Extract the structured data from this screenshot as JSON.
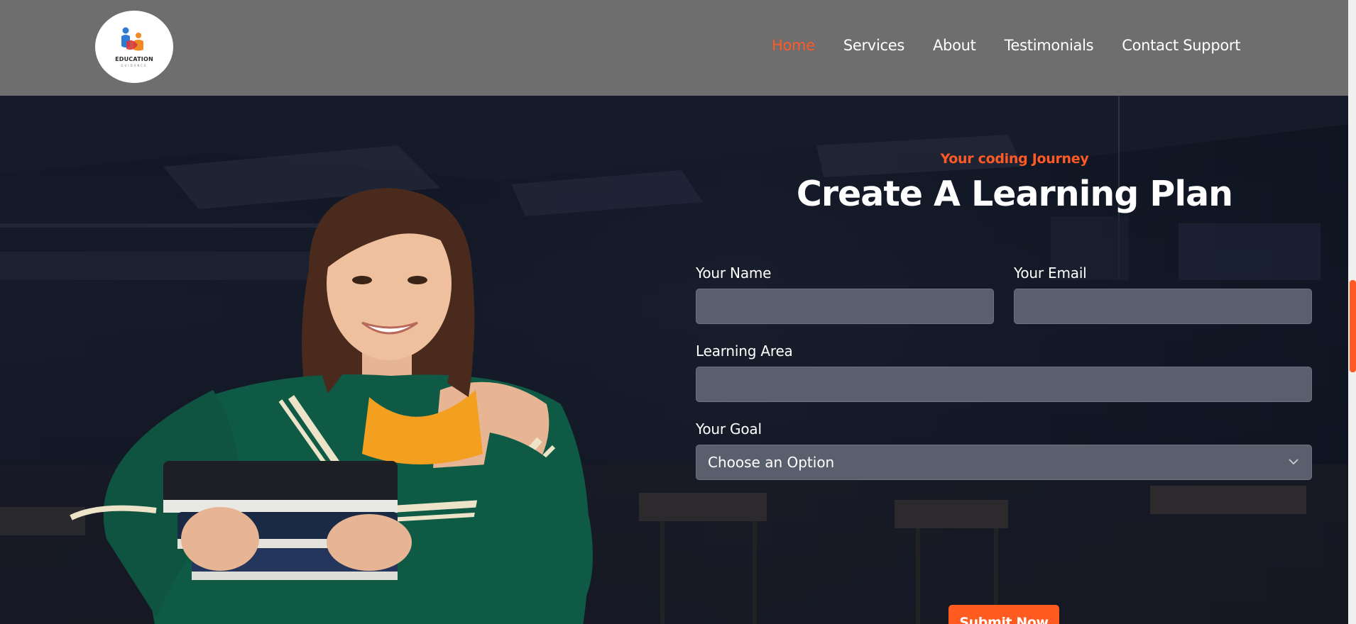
{
  "header": {
    "logo_text": "EDUCATION",
    "logo_subtext": "GUIDANCE",
    "nav": [
      {
        "label": "Home",
        "active": true
      },
      {
        "label": "Services",
        "active": false
      },
      {
        "label": "About",
        "active": false
      },
      {
        "label": "Testimonials",
        "active": false
      },
      {
        "label": "Contact Support",
        "active": false
      }
    ]
  },
  "form": {
    "eyebrow": "Your coding Journey",
    "title": "Create A Learning Plan",
    "name_label": "Your Name",
    "name_value": "",
    "email_label": "Your Email",
    "email_value": "",
    "area_label": "Learning Area",
    "area_value": "",
    "goal_label": "Your Goal",
    "goal_selected": "Choose an Option",
    "submit_label": "Submit Now"
  },
  "colors": {
    "accent": "#ff5a26",
    "header_bg": "#6e6e6e",
    "input_bg": "#5a5f6e",
    "text": "#ffffff"
  },
  "icons": [
    "logo-icon",
    "chevron-down-icon"
  ],
  "scrollbar": {
    "position_fraction": 0.45
  }
}
